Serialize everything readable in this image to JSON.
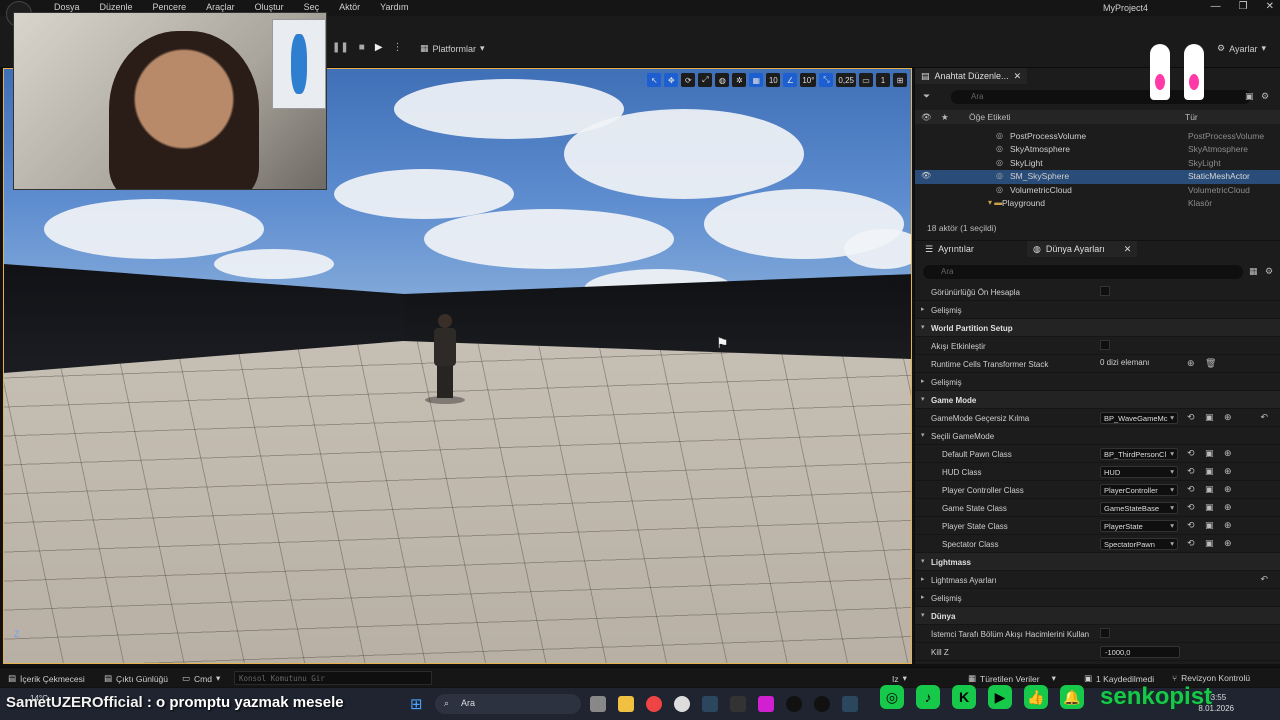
{
  "window": {
    "project_name": "MyProject4",
    "minimize": "—",
    "restore": "❐",
    "close": "✕"
  },
  "menu": [
    "Dosya",
    "Düzenle",
    "Pencere",
    "Araçlar",
    "Oluştur",
    "Seç",
    "Aktör",
    "Yardım"
  ],
  "toolbar": {
    "platforms_label": "Platformlar",
    "settings_label": "Ayarlar"
  },
  "viewport": {
    "tools": {
      "grid_snap": "10",
      "rotation_snap": "10°",
      "scale_snap": "0,25",
      "camera_speed": "1"
    },
    "axis_label": "Z"
  },
  "outliner": {
    "tab_label": "Anahtat Düzenle...",
    "search_placeholder": "Ara",
    "col_label": "Öğe Etiketi",
    "col_type": "Tür",
    "rows": [
      {
        "name": "PostProcessVolume",
        "type": "PostProcessVolume",
        "selected": false,
        "folder": false
      },
      {
        "name": "SkyAtmosphere",
        "type": "SkyAtmosphere",
        "selected": false,
        "folder": false
      },
      {
        "name": "SkyLight",
        "type": "SkyLight",
        "selected": false,
        "folder": false
      },
      {
        "name": "SM_SkySphere",
        "type": "StaticMeshActor",
        "selected": true,
        "folder": false
      },
      {
        "name": "VolumetricCloud",
        "type": "VolumetricCloud",
        "selected": false,
        "folder": false
      },
      {
        "name": "Playground",
        "type": "Klasör",
        "selected": false,
        "folder": true
      }
    ],
    "count_label": "18 aktör (1 seçildi)"
  },
  "details": {
    "tab_details": "Ayrıntılar",
    "tab_world_settings": "Dünya Ayarları",
    "search_placeholder": "Ara",
    "rows": [
      {
        "kind": "prop",
        "label": "Görünürlüğü Ön Hesapla",
        "indent": 1,
        "value_type": "checkbox"
      },
      {
        "kind": "sub",
        "label": "Gelişmiş",
        "indent": 0
      },
      {
        "kind": "cat",
        "label": "World Partition Setup"
      },
      {
        "kind": "prop",
        "label": "Akışı Etkinleştir",
        "indent": 1,
        "value_type": "checkbox"
      },
      {
        "kind": "prop",
        "label": "Runtime Cells Transformer Stack",
        "indent": 1,
        "value_type": "text",
        "value": "0 dizi elemanı",
        "icons": "⊕ 🗑"
      },
      {
        "kind": "sub",
        "label": "Gelişmiş",
        "indent": 0
      },
      {
        "kind": "cat",
        "label": "Game Mode"
      },
      {
        "kind": "prop",
        "label": "GameMode Geçersiz Kılma",
        "indent": 1,
        "value_type": "combo",
        "value": "BP_WaveGameMc",
        "icons": "⟲ ▣ ⊕",
        "reset": "↶"
      },
      {
        "kind": "subcat",
        "label": "Seçili GameMode"
      },
      {
        "kind": "prop",
        "label": "Default Pawn Class",
        "indent": 2,
        "value_type": "combo",
        "value": "BP_ThirdPersonCl",
        "icons": "⟲ ▣ ⊕"
      },
      {
        "kind": "prop",
        "label": "HUD Class",
        "indent": 2,
        "value_type": "combo",
        "value": "HUD",
        "icons": "⟲ ▣ ⊕"
      },
      {
        "kind": "prop",
        "label": "Player Controller Class",
        "indent": 2,
        "value_type": "combo",
        "value": "PlayerController",
        "icons": "⟲ ▣ ⊕"
      },
      {
        "kind": "prop",
        "label": "Game State Class",
        "indent": 2,
        "value_type": "combo",
        "value": "GameStateBase",
        "icons": "⟲ ▣ ⊕"
      },
      {
        "kind": "prop",
        "label": "Player State Class",
        "indent": 2,
        "value_type": "combo",
        "value": "PlayerState",
        "icons": "⟲ ▣ ⊕"
      },
      {
        "kind": "prop",
        "label": "Spectator Class",
        "indent": 2,
        "value_type": "combo",
        "value": "SpectatorPawn",
        "icons": "⟲ ▣ ⊕"
      },
      {
        "kind": "cat",
        "label": "Lightmass"
      },
      {
        "kind": "sub",
        "label": "Lightmass Ayarları",
        "indent": 0,
        "reset": "↶"
      },
      {
        "kind": "sub",
        "label": "Gelişmiş",
        "indent": 0
      },
      {
        "kind": "cat",
        "label": "Dünya"
      },
      {
        "kind": "prop",
        "label": "İstemci Tarafı Bölüm Akışı Hacimlerini Kullan",
        "indent": 1,
        "value_type": "checkbox"
      },
      {
        "kind": "prop",
        "label": "Kill Z",
        "indent": 1,
        "value_type": "number",
        "value": "-1000,0"
      }
    ]
  },
  "statusbar": {
    "content_drawer": "İçerik Çekmecesi",
    "output_log": "Çıktı Günlüğü",
    "cmd": "Cmd",
    "console_placeholder": "Konsol Komutunu Gir",
    "trace": "Iz",
    "derived_data": "Türetilen Veriler",
    "unsaved": "1 Kaydedilmedi",
    "revision_control": "Revizyon Kontrolü"
  },
  "taskbar": {
    "weather": "14°C",
    "search_label": "Ara",
    "time": "03:55",
    "date": "8.01.2026"
  },
  "stream": {
    "username": "SametUZEROfficial",
    "message": " : o promptu yazmak mesele",
    "handle": "senkopist",
    "colors": {
      "social_green": "#16c94a",
      "mascot_pink": "#ff3aa8"
    }
  }
}
